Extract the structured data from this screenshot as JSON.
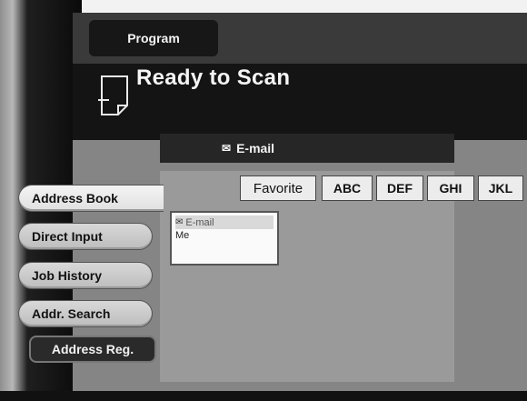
{
  "program_tab": {
    "label": "Program"
  },
  "title": "Ready to Scan",
  "section_header": {
    "icon": "mail-icon",
    "label": "E-mail"
  },
  "side_menu": [
    {
      "label": "Address Book",
      "selected": true
    },
    {
      "label": "Direct Input",
      "selected": false
    },
    {
      "label": "Job History",
      "selected": false
    },
    {
      "label": "Addr. Search",
      "selected": false
    }
  ],
  "address_reg_button": {
    "label": "Address Reg."
  },
  "index_keys": [
    "Favorite",
    "ABC",
    "DEF",
    "GHI",
    "JKL"
  ],
  "address_list": {
    "entry": {
      "type": "E-mail",
      "name": "Me"
    }
  }
}
